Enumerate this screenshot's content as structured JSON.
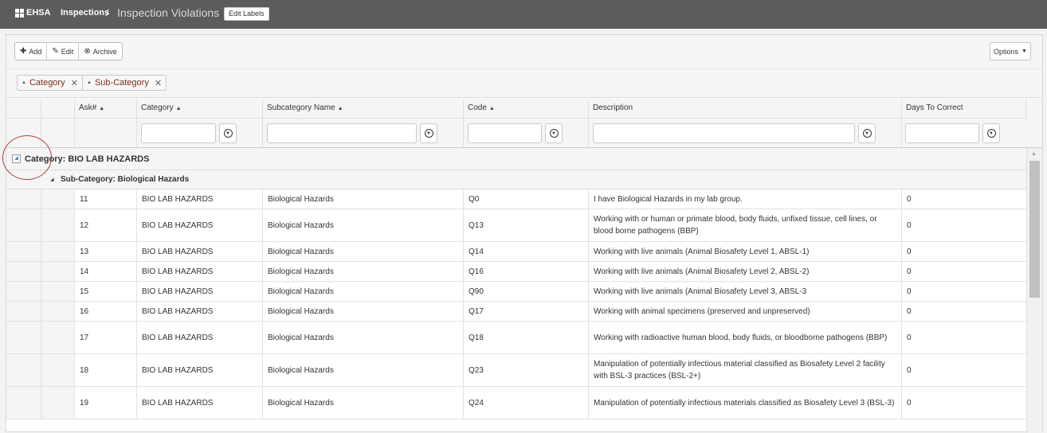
{
  "header": {
    "brand": "EHSA",
    "breadcrumb_link": "Inspections",
    "breadcrumb_sep": "/",
    "page_title": "Inspection Violations",
    "edit_labels": "Edit Labels",
    "bg_color": "#5c5c5c"
  },
  "toolbar": {
    "add": "Add",
    "edit": "Edit",
    "archive": "Archive",
    "options": "Options"
  },
  "groups": {
    "chip1": "Category",
    "chip2": "Sub-Category"
  },
  "columns": {
    "ask": "Ask#",
    "category": "Category",
    "subcategory": "Subcategory Name",
    "code": "Code",
    "description": "Description",
    "days": "Days To Correct"
  },
  "group_rows": {
    "category": "Category: BIO LAB HAZARDS",
    "subcategory": "Sub-Category: Biological Hazards"
  },
  "rows": [
    {
      "ask": "11",
      "category": "BIO LAB HAZARDS",
      "sub": "Biological Hazards",
      "code": "Q0",
      "desc": "I have Biological Hazards in my lab group.",
      "days": "0"
    },
    {
      "ask": "12",
      "category": "BIO LAB HAZARDS",
      "sub": "Biological Hazards",
      "code": "Q13",
      "desc": "Working with or human or primate blood, body fluids, unfixed tissue, cell lines, or blood borne pathogens (BBP)",
      "days": "0"
    },
    {
      "ask": "13",
      "category": "BIO LAB HAZARDS",
      "sub": "Biological Hazards",
      "code": "Q14",
      "desc": "Working with live animals (Animal Biosafety Level 1, ABSL-1)",
      "days": "0"
    },
    {
      "ask": "14",
      "category": "BIO LAB HAZARDS",
      "sub": "Biological Hazards",
      "code": "Q16",
      "desc": "Working with live animals (Animal Biosafety Level 2, ABSL-2)",
      "days": "0"
    },
    {
      "ask": "15",
      "category": "BIO LAB HAZARDS",
      "sub": "Biological Hazards",
      "code": "Q90",
      "desc": "Working with live animals (Animal Biosafety Level 3, ABSL-3",
      "days": "0"
    },
    {
      "ask": "16",
      "category": "BIO LAB HAZARDS",
      "sub": "Biological Hazards",
      "code": "Q17",
      "desc": "Working with animal specimens (preserved and unpreserved)",
      "days": "0"
    },
    {
      "ask": "17",
      "category": "BIO LAB HAZARDS",
      "sub": "Biological Hazards",
      "code": "Q18",
      "desc": "Working with radioactive human blood, body fluids, or bloodborne pathogens (BBP)",
      "days": "0"
    },
    {
      "ask": "18",
      "category": "BIO LAB HAZARDS",
      "sub": "Biological Hazards",
      "code": "Q23",
      "desc": "Manipulation of potentially infectious material classified as Biosafety Level 2 facility with BSL-3 practices (BSL-2+)",
      "days": "0"
    },
    {
      "ask": "19",
      "category": "BIO LAB HAZARDS",
      "sub": "Biological Hazards",
      "code": "Q24",
      "desc": "Manipulation of potentially infectious materials classified as Biosafety Level 3 (BSL-3)",
      "days": "0"
    }
  ]
}
